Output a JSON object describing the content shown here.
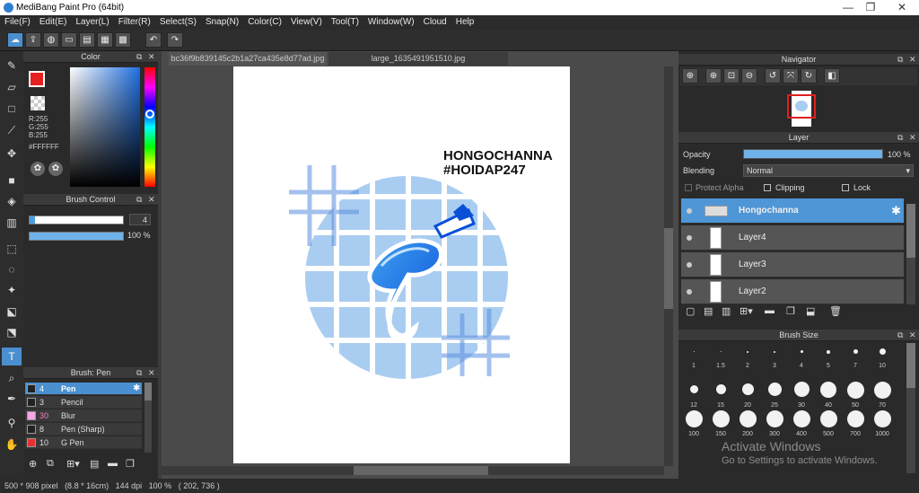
{
  "window": {
    "title": "MediBang Paint Pro (64bit)",
    "min": "—",
    "max": "❐",
    "close": "✕"
  },
  "menu": [
    "File(F)",
    "Edit(E)",
    "Layer(L)",
    "Filter(R)",
    "Select(S)",
    "Snap(N)",
    "Color(C)",
    "View(V)",
    "Tool(T)",
    "Window(W)",
    "Cloud",
    "Help"
  ],
  "color_panel": {
    "title": "Color",
    "r": "R:255",
    "g": "G:255",
    "b": "B:255",
    "hex": "#FFFFFF"
  },
  "brush_control": {
    "title": "Brush Control",
    "size": "4",
    "opacity": "100 %"
  },
  "brush_panel": {
    "title": "Brush: Pen",
    "items": [
      {
        "num": "4",
        "name": "Pen",
        "color": "#222222"
      },
      {
        "num": "3",
        "name": "Pencil",
        "color": "#222222"
      },
      {
        "num": "30",
        "name": "Blur",
        "color": "#f5a6e6"
      },
      {
        "num": "8",
        "name": "Pen (Sharp)",
        "color": "#222222"
      },
      {
        "num": "10",
        "name": "G Pen",
        "color": "#e53030"
      }
    ]
  },
  "tabs": [
    "bc36f9b839145c2b1a27ca435e8d77ad.jpg",
    "large_1635491951510.jpg"
  ],
  "artwork": {
    "line1": "HONGOCHANNA",
    "line2": "#HOIDAP247"
  },
  "navigator": {
    "title": "Navigator"
  },
  "layer_panel": {
    "title": "Layer",
    "opacity_label": "Opacity",
    "opacity_value": "100 %",
    "blending_label": "Blending",
    "blending_value": "Normal",
    "protect_alpha": "Protect Alpha",
    "clipping": "Clipping",
    "lock": "Lock",
    "layers": [
      "Hongochanna",
      "Layer4",
      "Layer3",
      "Layer2"
    ]
  },
  "brush_size": {
    "title": "Brush Size",
    "sizes": [
      "1",
      "1.5",
      "2",
      "3",
      "4",
      "5",
      "7",
      "10",
      "12",
      "15",
      "20",
      "25",
      "30",
      "40",
      "50",
      "70",
      "100",
      "150",
      "200",
      "300",
      "400",
      "500",
      "700",
      "1000"
    ]
  },
  "activate": {
    "line1": "Activate Windows",
    "line2": "Go to Settings to activate Windows."
  },
  "status": {
    "pixels": "500 * 908 pixel",
    "cm": "(8.8 * 16cm)",
    "dpi": "144 dpi",
    "zoom": "100 %",
    "coords": "( 202, 736 )"
  }
}
